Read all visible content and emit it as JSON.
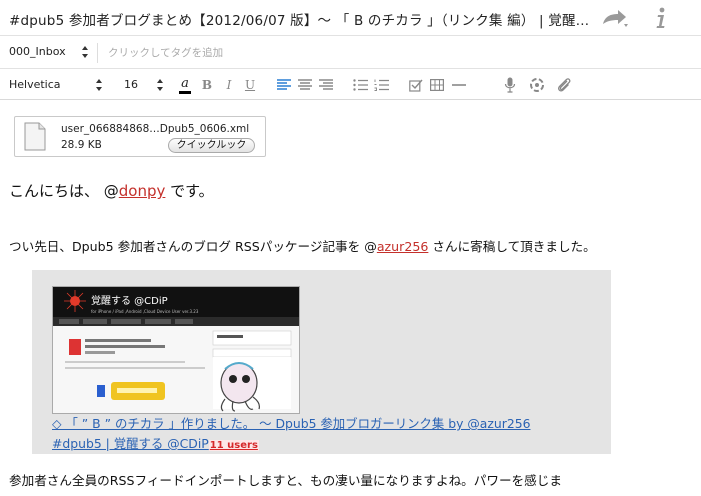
{
  "window": {
    "title": "#dpub5 参加者ブログまとめ【2012/06/07 版】～ 「 B のチカラ 」（リンク集 編） | 覚醒す…",
    "share_icon": "share-arrow-icon",
    "info_icon": "info-icon"
  },
  "tagbar": {
    "notebook": "000_Inbox",
    "tag_placeholder": "クリックしてタグを追加"
  },
  "toolbar": {
    "font": "Helvetica",
    "size": "16",
    "buttons": [
      "font-color",
      "bold",
      "italic",
      "underline",
      "align-left",
      "align-center",
      "align-right",
      "bullet-list",
      "numbered-list",
      "checkbox",
      "table",
      "horizontal-rule",
      "microphone",
      "attachment-sync",
      "paperclip"
    ],
    "bold_label": "B",
    "italic_label": "I",
    "underline_label": "U",
    "color_label": "a",
    "accent_color": "#2a7fd4",
    "font_color_bar": "#000000"
  },
  "attachment": {
    "filename": "user_066884868…Dpub5_0606.xml",
    "size": "28.9 KB",
    "quicklook_label": "クイックルック"
  },
  "body": {
    "greeting_pre": "こんにちは、 @",
    "greeting_handle": "donpy",
    "greeting_post": " です。",
    "para2_pre": "つい先日、Dpub5 参加者さんのブログ RSSパッケージ記事を @",
    "para2_handle": "azur256",
    "para2_post": " さんに寄稿して頂きました。",
    "quote": {
      "thumb_site": "覚醒する @CDiP",
      "thumb_tagline": "for iPhone / iPad ,Android ,Cloud Device User ver.3.23",
      "link_line1": "◇ 「 ” B ” のチカラ 」作りました。 ～ Dpub5 参加ブロガーリンク集 by @azur256",
      "link_line2": "#dpub5 | 覚醒する @CDiP",
      "users_badge": "11 users"
    },
    "para3": "参加者さん全員のRSSフィードインポートしますと、もの凄い量になりますよね。パワーを感じま"
  },
  "colors": {
    "mention": "#c4302b",
    "link": "#2a62b3",
    "quote_bg": "#e4e4e4",
    "badge": "#d6282a"
  }
}
